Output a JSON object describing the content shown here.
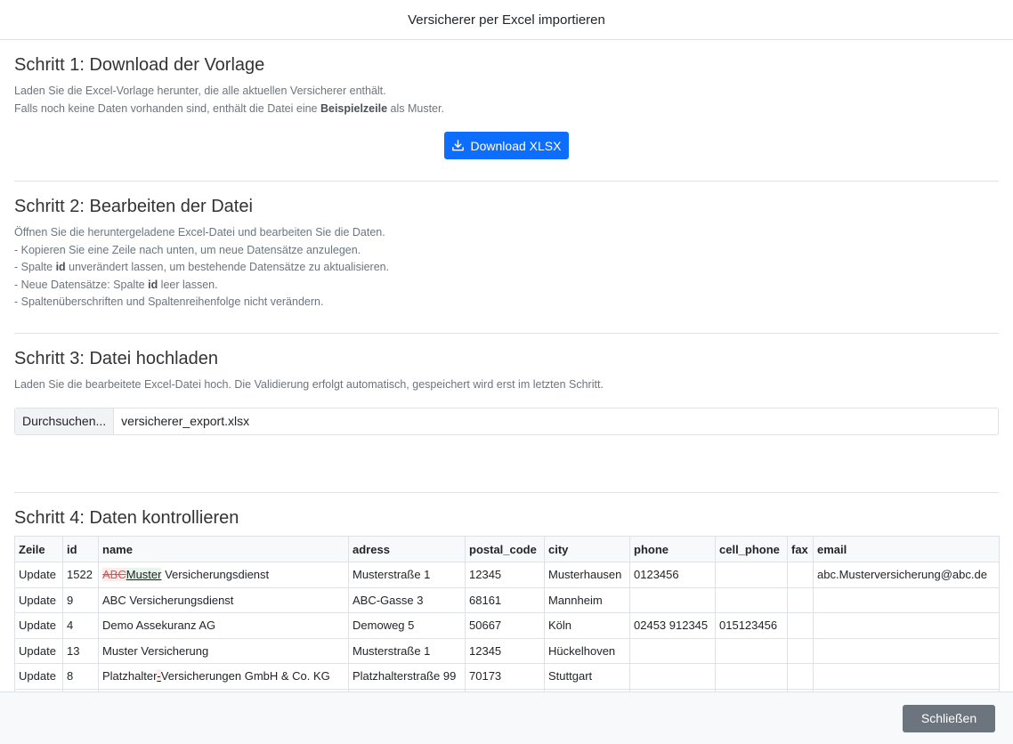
{
  "modal": {
    "title": "Versicherer per Excel importieren",
    "close_label": "Schließen"
  },
  "step1": {
    "title": "Schritt 1: Download der Vorlage",
    "line1": "Laden Sie die Excel-Vorlage herunter, die alle aktuellen Versicherer enthält.",
    "line2_pre": "Falls noch keine Daten vorhanden sind, enthält die Datei eine ",
    "line2_bold": "Beispielzeile",
    "line2_post": " als Muster.",
    "download_label": "Download XLSX",
    "download_icon": "download-icon"
  },
  "step2": {
    "title": "Schritt 2: Bearbeiten der Datei",
    "line1": "Öffnen Sie die heruntergeladene Excel-Datei und bearbeiten Sie die Daten.",
    "line2": "- Kopieren Sie eine Zeile nach unten, um neue Datensätze anzulegen.",
    "line3_pre": "- Spalte ",
    "line3_bold": "id",
    "line3_post": " unverändert lassen, um bestehende Datensätze zu aktualisieren.",
    "line4_pre": "- Neue Datensätze: Spalte ",
    "line4_bold": "id",
    "line4_post": " leer lassen.",
    "line5": "- Spaltenüberschriften und Spaltenreihenfolge nicht verändern."
  },
  "step3": {
    "title": "Schritt 3: Datei hochladen",
    "line1": "Laden Sie die bearbeitete Excel-Datei hoch. Die Validierung erfolgt automatisch, gespeichert wird erst im letzten Schritt.",
    "browse_label": "Durchsuchen...",
    "file_name": "versicherer_export.xlsx"
  },
  "step4": {
    "title": "Schritt 4: Daten kontrollieren",
    "columns": [
      "Zeile",
      "id",
      "name",
      "adress",
      "postal_code",
      "city",
      "phone",
      "cell_phone",
      "fax",
      "email"
    ],
    "rows": [
      {
        "zeile": "Update",
        "id": "1522",
        "name_del": "ABC",
        "name_ins": "Muster",
        "name_rest": " Versicherungsdienst",
        "adress": "Musterstraße 1",
        "postal_code": "12345",
        "city": "Musterhausen",
        "phone": "0123456",
        "cell_phone": "",
        "fax": "",
        "email": "abc.Musterversicherung@abc.de"
      },
      {
        "zeile": "Update",
        "id": "9",
        "name": "ABC Versicherungsdienst",
        "adress": "ABC-Gasse 3",
        "postal_code": "68161",
        "city": "Mannheim",
        "phone": "",
        "cell_phone": "",
        "fax": "",
        "email": ""
      },
      {
        "zeile": "Update",
        "id": "4",
        "name": "Demo Assekuranz AG",
        "adress": "Demoweg 5",
        "postal_code": "50667",
        "city": "Köln",
        "phone": "02453 912345",
        "cell_phone": "015123456",
        "fax": "",
        "email": ""
      },
      {
        "zeile": "Update",
        "id": "13",
        "name": "Muster Versicherung",
        "adress": "Musterstraße 1",
        "postal_code": "12345",
        "city": "Hückelhoven",
        "phone": "",
        "cell_phone": "",
        "fax": "",
        "email": ""
      },
      {
        "zeile": "Update",
        "id": "8",
        "name_pre": "Platzhalter",
        "name_ins": "-",
        "name_rest": "Versicherungen GmbH & Co. KG",
        "adress": "Platzhalterstraße 99",
        "postal_code": "70173",
        "city": "Stuttgart",
        "phone": "",
        "cell_phone": "",
        "fax": "",
        "email": ""
      },
      {
        "zeile": "",
        "id": "",
        "name": "",
        "adress": "",
        "postal_code": "",
        "city": "",
        "phone": "",
        "cell_phone": "",
        "fax": "",
        "email": ""
      }
    ]
  }
}
